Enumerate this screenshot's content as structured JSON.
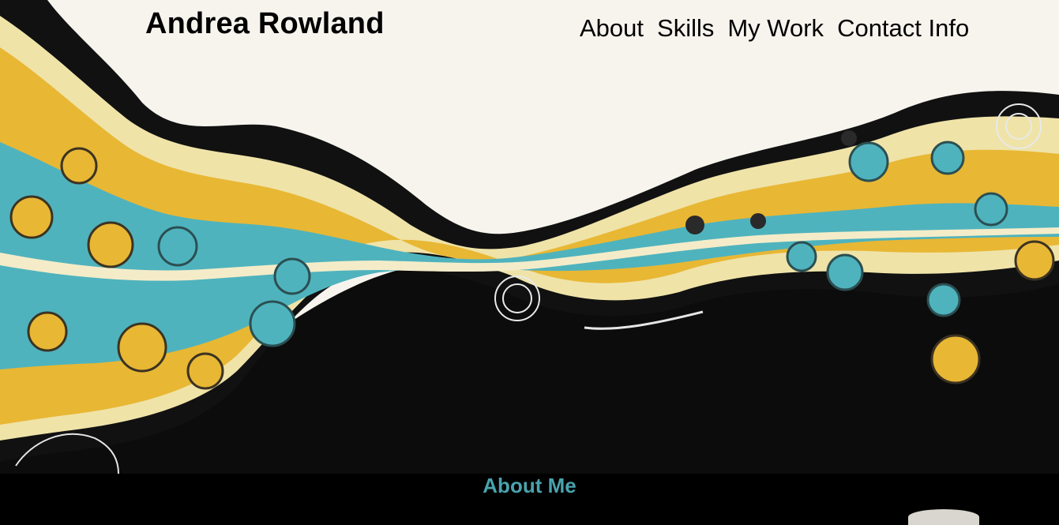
{
  "header": {
    "site_title": "Andrea Rowland"
  },
  "nav": {
    "items": [
      {
        "label": "About"
      },
      {
        "label": "Skills"
      },
      {
        "label": "My Work"
      },
      {
        "label": "Contact Info"
      }
    ]
  },
  "section": {
    "heading": "About Me"
  },
  "colors": {
    "accent": "#49a3ad",
    "background_light": "#f7f4ee",
    "background_dark": "#000000",
    "paint_gold": "#e8b734",
    "paint_teal": "#4fb3bd",
    "paint_cream": "#efe3a8"
  }
}
